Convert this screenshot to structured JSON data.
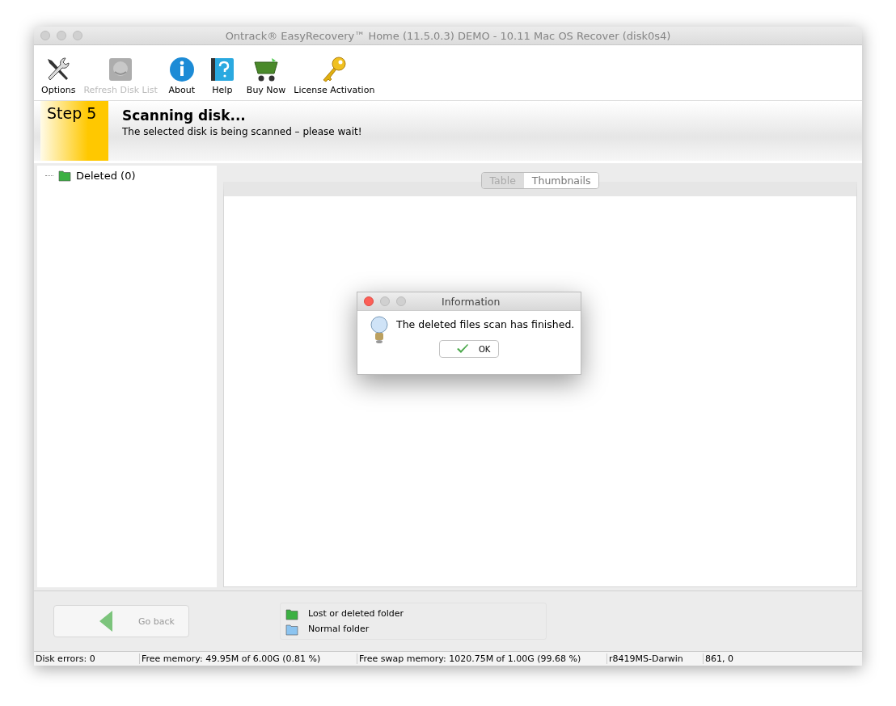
{
  "window": {
    "title": "Ontrack® EasyRecovery™ Home (11.5.0.3) DEMO - 10.11 Mac OS Recover (disk0s4)"
  },
  "toolbar": [
    {
      "kind": "tools",
      "label": "Options",
      "disabled": false
    },
    {
      "kind": "disk",
      "label": "Refresh Disk List",
      "disabled": true
    },
    {
      "kind": "info",
      "label": "About",
      "disabled": false
    },
    {
      "kind": "help",
      "label": "Help",
      "disabled": false
    },
    {
      "kind": "cart",
      "label": "Buy Now",
      "disabled": false
    },
    {
      "kind": "key",
      "label": "License Activation",
      "disabled": false
    }
  ],
  "step": {
    "badge": "Step 5",
    "title": "Scanning disk...",
    "subtitle": "The selected disk is being scanned – please wait!"
  },
  "tree": [
    {
      "label": "Deleted (0)",
      "color": "#3cb043"
    }
  ],
  "view_tabs": [
    {
      "label": "Table",
      "selected": true
    },
    {
      "label": "Thumbnails",
      "selected": false
    }
  ],
  "dialog": {
    "title": "Information",
    "message": "The deleted files scan has finished.",
    "button": "OK"
  },
  "back_button": {
    "label": "Go back",
    "disabled": true
  },
  "legend": [
    {
      "label": "Lost or deleted folder",
      "color": "#3cb043"
    },
    {
      "label": "Normal folder",
      "color": "#8cc4f0"
    }
  ],
  "status_bar": [
    "Disk errors: 0",
    "Free memory: 49.95M of 6.00G (0.81 %)",
    "Free swap memory: 1020.75M of 1.00G (99.68 %)",
    "r8419MS-Darwin",
    "861, 0"
  ]
}
